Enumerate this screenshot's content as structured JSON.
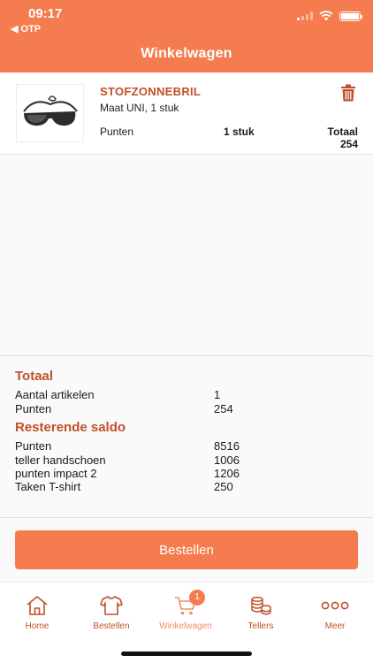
{
  "status_bar": {
    "time": "09:17",
    "back_label": "◀ OTP"
  },
  "header": {
    "title": "Winkelwagen"
  },
  "cart_item": {
    "name": "STOFZONNEBRIL",
    "subtitle": "Maat UNI, 1 stuk",
    "points_label": "Punten",
    "quantity": "1 stuk",
    "total": "Totaal 254"
  },
  "summary": {
    "total_title": "Totaal",
    "total_rows": [
      {
        "label": "Aantal artikelen",
        "value": "1"
      },
      {
        "label": "Punten",
        "value": "254"
      }
    ],
    "remaining_title": "Resterende saldo",
    "remaining_rows": [
      {
        "label": "Punten",
        "value": "8516"
      },
      {
        "label": "teller handschoen",
        "value": "1006"
      },
      {
        "label": "punten impact 2",
        "value": "1206"
      },
      {
        "label": "Taken T-shirt",
        "value": "250"
      }
    ]
  },
  "order_button": {
    "label": "Bestellen"
  },
  "tabbar": {
    "items": [
      {
        "label": "Home",
        "icon": "home-icon"
      },
      {
        "label": "Bestellen",
        "icon": "shirt-icon"
      },
      {
        "label": "Winkelwagen",
        "icon": "cart-icon",
        "badge": "1"
      },
      {
        "label": "Tellers",
        "icon": "coins-icon"
      },
      {
        "label": "Meer",
        "icon": "more-icon"
      }
    ]
  },
  "colors": {
    "accent": "#f47c4e",
    "accent_dark": "#c0502a"
  }
}
